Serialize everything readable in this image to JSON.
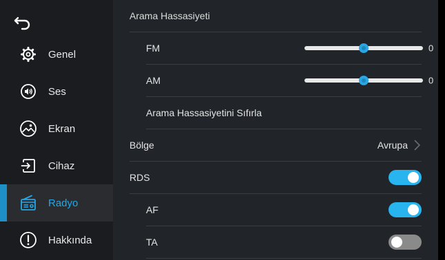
{
  "sidebar": {
    "items": [
      {
        "label": "Genel",
        "icon": "gear-icon",
        "active": false
      },
      {
        "label": "Ses",
        "icon": "speaker-icon",
        "active": false
      },
      {
        "label": "Ekran",
        "icon": "display-icon",
        "active": false
      },
      {
        "label": "Cihaz",
        "icon": "device-icon",
        "active": false
      },
      {
        "label": "Radyo",
        "icon": "radio-icon",
        "active": true
      },
      {
        "label": "Hakkında",
        "icon": "info-icon",
        "active": false
      }
    ]
  },
  "settings": {
    "sensitivity_title": "Arama Hassasiyeti",
    "fm": {
      "label": "FM",
      "value": "0",
      "level": 0.5
    },
    "am": {
      "label": "AM",
      "value": "0",
      "level": 0.5
    },
    "reset_label": "Arama Hassasiyetini Sıfırla",
    "region": {
      "label": "Bölge",
      "value": "Avrupa"
    },
    "rds": {
      "label": "RDS",
      "on": true
    },
    "af": {
      "label": "AF",
      "on": true
    },
    "ta": {
      "label": "TA",
      "on": false
    }
  },
  "colors": {
    "accent": "#23a8e6",
    "toggle_on": "#27b4ef",
    "toggle_off": "#8a8a8a"
  }
}
